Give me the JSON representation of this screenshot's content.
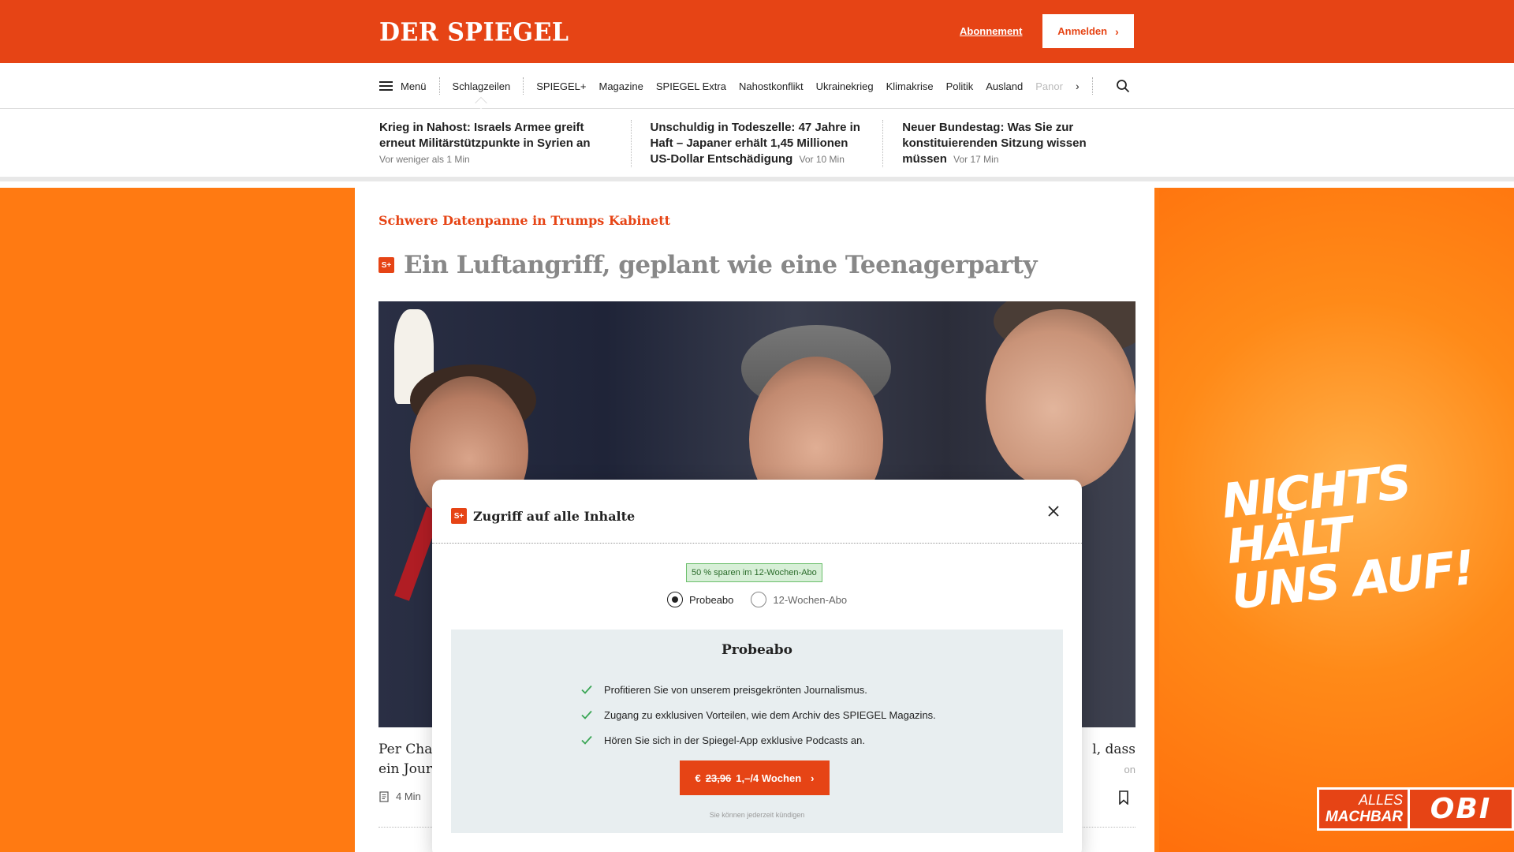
{
  "header": {
    "logo": "DER SPIEGEL",
    "subscribe_link": "Abonnement",
    "login_button": "Anmelden"
  },
  "nav": {
    "menu_label": "Menü",
    "items": [
      "Schlagzeilen",
      "SPIEGEL+",
      "Magazine",
      "SPIEGEL Extra",
      "Nahostkonflikt",
      "Ukrainekrieg",
      "Klimakrise",
      "Politik",
      "Ausland"
    ],
    "truncated_item": "Panor",
    "icons": [
      "hamburger-icon",
      "chevron-right-icon",
      "search-icon"
    ]
  },
  "ticker": [
    {
      "title": "Krieg in Nahost: Israels Armee greift erneut Militärstützpunkte in Syrien an",
      "time": "Vor weniger als 1 Min"
    },
    {
      "title": "Unschuldig in Todeszelle: 47 Jahre in Haft – Japaner erhält 1,45 Millionen US-Dollar Entschädigung",
      "time": "Vor 10 Min"
    },
    {
      "title": "Neuer Bundestag: Was Sie zur konstituierenden Sitzung wissen müssen",
      "time": "Vor 17 Min"
    }
  ],
  "article": {
    "kicker": "Schwere Datenpanne in Trumps Kabinett",
    "badge": "S+",
    "headline": "Ein Luftangriff, geplant wie eine Teenagerparty",
    "teaser_left_1": "Per Chat",
    "teaser_left_2": "ein Journ",
    "teaser_right_1": "l, dass",
    "teaser_right_2": "on",
    "read_time": "4 Min"
  },
  "modal": {
    "badge": "S+",
    "title": "Zugriff auf alle Inhalte",
    "savings_badge": "50 % sparen im 12-Wochen-Abo",
    "options": [
      {
        "label": "Probeabo",
        "selected": true
      },
      {
        "label": "12-Wochen-Abo",
        "selected": false
      }
    ],
    "plan_title": "Probeabo",
    "features": [
      "Profitieren Sie von unserem preisgekrönten Journalismus.",
      "Zugang zu exklusiven Vorteilen, wie dem Archiv des SPIEGEL Magazins.",
      "Hören Sie sich in der Spiegel-App exklusive Podcasts an."
    ],
    "cta_prefix": "€",
    "cta_old_price": "23,96",
    "cta_new_price": "1,–/4 Wochen",
    "cancel_note": "Sie können jederzeit kündigen"
  },
  "ad": {
    "slogan_line1": "NICHTS HÄLT",
    "slogan_line2": "UNS AUF!",
    "alles": "ALLES",
    "machbar": "MACHBAR",
    "brand": "OBI"
  },
  "colors": {
    "brand": "#e64415",
    "ad_orange": "#ff7a12",
    "check_green": "#3aa655"
  }
}
